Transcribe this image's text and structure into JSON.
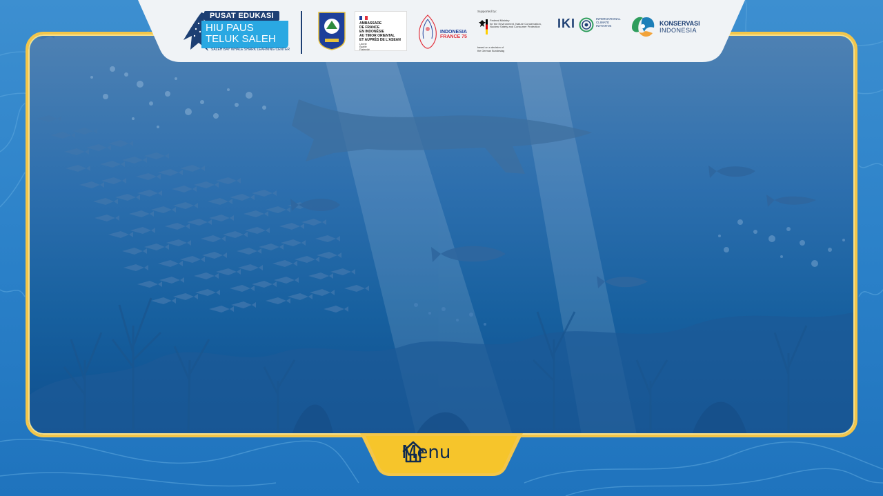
{
  "header": {
    "logo": {
      "top_label": "PUSAT EDUKASI",
      "line1": "HIU PAUS",
      "line2": "TELUK SALEH",
      "sub_label": "SALEH BAY WHALE SHARK LEARNING CENTER"
    },
    "ambassade": {
      "text": "AMBASSADE\nDE FRANCE\nEN INDONÉSIE\nAU TIMOR ORIENTAL\nET AUPRÈS DE L'ASEAN",
      "motto": "Liberté\nÉgalité\nFraternité"
    },
    "indonesia_france": {
      "line1": "INDONESIA",
      "line2": "FRANCE 75"
    },
    "bmu": {
      "supported_by": "Supported by:",
      "ministry": "Federal Ministry\nfor the Environment, Nature Conservation,\nNuclear Safety and Consumer Protection",
      "decision": "based on a decision of\nthe German Bundestag"
    },
    "iki": {
      "abbr": "IKI",
      "full": "INTERNATIONAL\nCLIMATE\nINITIATIVE"
    },
    "konservasi": {
      "line1": "KONSERVASI",
      "line2": "INDONESIA"
    }
  },
  "menu": {
    "label": "Menu",
    "icon": "home-icon"
  },
  "colors": {
    "frame_border": "#f3c64a",
    "menu_yellow": "#f6c52b",
    "header_bg": "#f0f3f6",
    "navy": "#1d3f73"
  }
}
